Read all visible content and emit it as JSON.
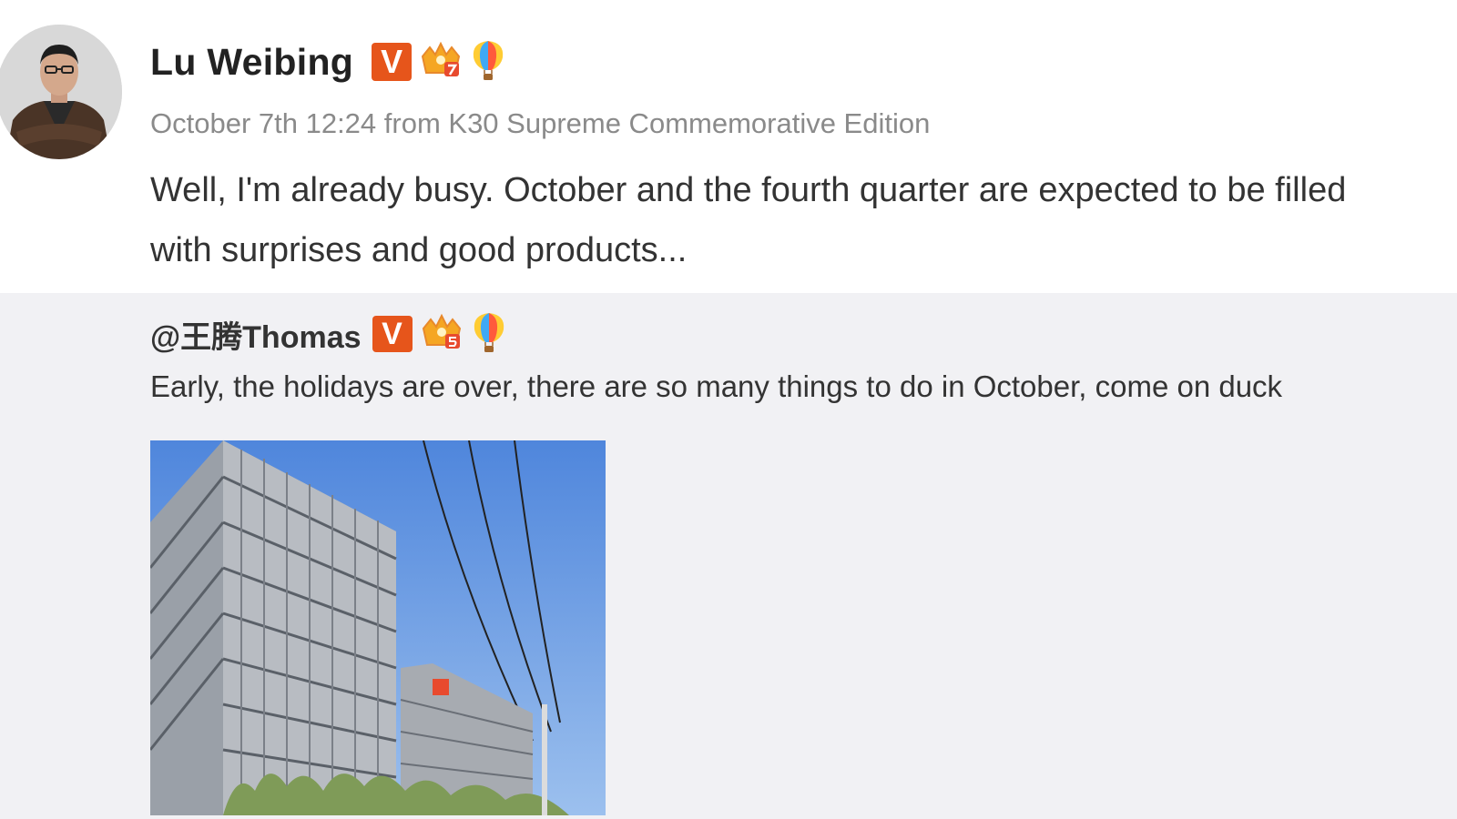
{
  "post": {
    "author": "Lu Weibing",
    "meta": "October 7th 12:24 from K30 Supreme Commemorative Edition",
    "text_lines": [
      "Well, I'm already busy. October and the fourth quarter are expected to be filled",
      "with surprises and good products..."
    ],
    "badges": {
      "verified": "V"
    }
  },
  "repost": {
    "user": "@王腾Thomas",
    "badges": {
      "verified": "V"
    },
    "text": "Early, the holidays are over, there are so many things to do in October, come on duck"
  },
  "icons": [
    "avatar-photo",
    "verified-badge-icon",
    "crown-level-icon",
    "hot-air-balloon-icon"
  ],
  "colors": {
    "verified_badge": "#e6551b",
    "repost_bg": "#f1f1f4",
    "meta_text": "#8a8a8a"
  }
}
